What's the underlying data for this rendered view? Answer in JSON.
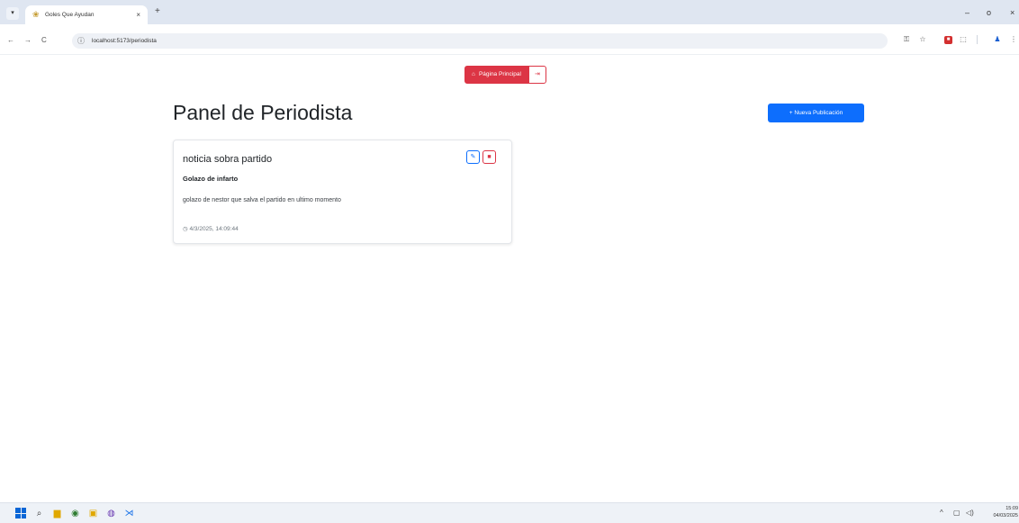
{
  "browser": {
    "tab_title": "Goles Que Ayudan",
    "tab_close": "×",
    "new_tab": "+",
    "url": "localhost:5173/periodista",
    "window_controls": {
      "minimize": "–",
      "maximize": "o",
      "close": "×"
    },
    "icons": [
      "tab-menu-icon",
      "favicon-icon",
      "back-icon",
      "forward-icon",
      "reload-icon",
      "site-info-icon",
      "password-key-icon",
      "star-icon",
      "extension-red-icon",
      "extensions-icon",
      "profile-icon",
      "menu-icon"
    ]
  },
  "header": {
    "home_label": "Página Principal",
    "home_icon": "home-icon",
    "logout_icon": "logout-icon"
  },
  "main": {
    "title": "Panel de Periodista",
    "new_post_label": "Nueva Publicación",
    "new_post_icon": "plus-icon"
  },
  "posts": [
    {
      "title": "noticia sobra partido",
      "subtitle": "Golazo de infarto",
      "body": "golazo de nestor que salva el partido en ultimo momento",
      "timestamp": "4/3/2025, 14:09:44",
      "edit_icon": "edit-icon",
      "delete_icon": "trash-icon",
      "time_icon": "clock-icon"
    }
  ],
  "taskbar": {
    "apps": [
      "windows-start-icon",
      "search-icon",
      "file-explorer-icon",
      "chrome-icon",
      "calendar-icon",
      "app-icon",
      "vscode-icon"
    ],
    "clock_time": "15:09",
    "clock_date": "04/03/2025"
  },
  "colors": {
    "danger": "#dc3545",
    "primary": "#0d6efd",
    "tabstrip": "#dfe6f1"
  }
}
